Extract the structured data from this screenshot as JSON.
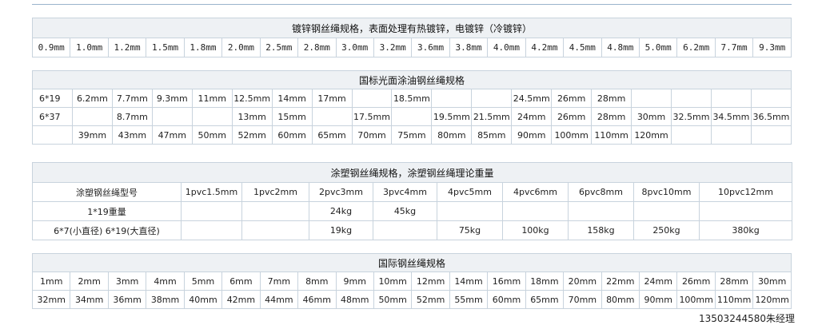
{
  "t1": {
    "title": "镀锌钢丝绳规格，表面处理有热镀锌，电镀锌（冷镀锌）",
    "cells": [
      "0.9mm",
      "1.0mm",
      "1.2mm",
      "1.5mm",
      "1.8mm",
      "2.0mm",
      "2.5mm",
      "2.8mm",
      "3.0mm",
      "3.2mm",
      "3.6mm",
      "3.8mm",
      "4.0mm",
      "4.2mm",
      "4.5mm",
      "4.8mm",
      "5.0mm",
      "6.2mm",
      "7.7mm",
      "9.3mm"
    ]
  },
  "t2": {
    "title": "国标光面涂油钢丝绳规格",
    "rows": [
      [
        "6*19",
        "6.2mm",
        "7.7mm",
        "9.3mm",
        "11mm",
        "12.5mm",
        "14mm",
        "17mm",
        "",
        "18.5mm",
        "",
        "",
        "24.5mm",
        "26mm",
        "28mm",
        "",
        "",
        "",
        ""
      ],
      [
        "6*37",
        "",
        "8.7mm",
        "",
        "",
        "13mm",
        "15mm",
        "",
        "17.5mm",
        "",
        "19.5mm",
        "21.5mm",
        "24mm",
        "26mm",
        "28mm",
        "30mm",
        "32.5mm",
        "34.5mm",
        "36.5mm"
      ],
      [
        "",
        "39mm",
        "43mm",
        "47mm",
        "50mm",
        "52mm",
        "60mm",
        "65mm",
        "70mm",
        "75mm",
        "80mm",
        "85mm",
        "90mm",
        "100mm",
        "110mm",
        "120mm",
        "",
        "",
        ""
      ]
    ]
  },
  "t3": {
    "title": "涂塑钢丝绳规格，涂塑钢丝绳理论重量",
    "header": [
      "涂塑钢丝绳型号",
      "1pvc1.5mm",
      "1pvc2mm",
      "2pvc3mm",
      "3pvc4mm",
      "4pvc5mm",
      "4pvc6mm",
      "6pvc8mm",
      "8pvc10mm",
      "10pvc12mm"
    ],
    "row1": [
      "1*19重量",
      "",
      "",
      "24kg",
      "45kg",
      "",
      "",
      "",
      "",
      ""
    ],
    "row2": [
      "6*7(小直径) 6*19(大直径)",
      "",
      "",
      "19kg",
      "",
      "75kg",
      "100kg",
      "158kg",
      "250kg",
      "380kg"
    ]
  },
  "t4": {
    "title": "国际钢丝绳规格",
    "row1": [
      "1mm",
      "2mm",
      "3mm",
      "4mm",
      "5mm",
      "6mm",
      "7mm",
      "8mm",
      "9mm",
      "10mm",
      "12mm",
      "14mm",
      "16mm",
      "18mm",
      "20mm",
      "22mm",
      "24mm",
      "26mm",
      "28mm",
      "30mm"
    ],
    "row2": [
      "32mm",
      "34mm",
      "36mm",
      "38mm",
      "40mm",
      "42mm",
      "44mm",
      "46mm",
      "48mm",
      "50mm",
      "52mm",
      "55mm",
      "60mm",
      "65mm",
      "70mm",
      "80mm",
      "90mm",
      "100mm",
      "110mm",
      "120mm"
    ]
  },
  "footer": "13503244580朱经理"
}
